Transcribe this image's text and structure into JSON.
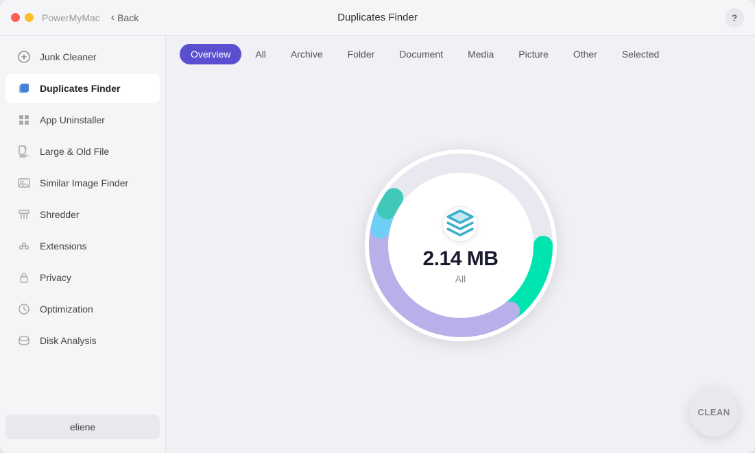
{
  "titlebar": {
    "app_name": "PowerMyMac",
    "back_label": "Back",
    "title": "Duplicates Finder",
    "help_label": "?"
  },
  "sidebar": {
    "items": [
      {
        "id": "junk-cleaner",
        "label": "Junk Cleaner",
        "icon": "junk"
      },
      {
        "id": "duplicates-finder",
        "label": "Duplicates Finder",
        "icon": "duplicates",
        "active": true
      },
      {
        "id": "app-uninstaller",
        "label": "App Uninstaller",
        "icon": "app"
      },
      {
        "id": "large-old-file",
        "label": "Large & Old File",
        "icon": "large"
      },
      {
        "id": "similar-image-finder",
        "label": "Similar Image Finder",
        "icon": "image"
      },
      {
        "id": "shredder",
        "label": "Shredder",
        "icon": "shredder"
      },
      {
        "id": "extensions",
        "label": "Extensions",
        "icon": "extensions"
      },
      {
        "id": "privacy",
        "label": "Privacy",
        "icon": "privacy"
      },
      {
        "id": "optimization",
        "label": "Optimization",
        "icon": "optimization"
      },
      {
        "id": "disk-analysis",
        "label": "Disk Analysis",
        "icon": "disk"
      }
    ],
    "user": "eliene"
  },
  "tabs": [
    {
      "id": "overview",
      "label": "Overview",
      "active": true
    },
    {
      "id": "all",
      "label": "All"
    },
    {
      "id": "archive",
      "label": "Archive"
    },
    {
      "id": "folder",
      "label": "Folder"
    },
    {
      "id": "document",
      "label": "Document"
    },
    {
      "id": "media",
      "label": "Media"
    },
    {
      "id": "picture",
      "label": "Picture"
    },
    {
      "id": "other",
      "label": "Other"
    },
    {
      "id": "selected",
      "label": "Selected"
    }
  ],
  "chart": {
    "value": "2.14 MB",
    "label": "All"
  },
  "clean_button": "CLEAN",
  "colors": {
    "accent_purple": "#5a4fcf",
    "teal": "#00e5b0",
    "lavender": "#b0a8e0",
    "light_blue": "#6ecff6",
    "small_teal": "#5fd8c8"
  }
}
